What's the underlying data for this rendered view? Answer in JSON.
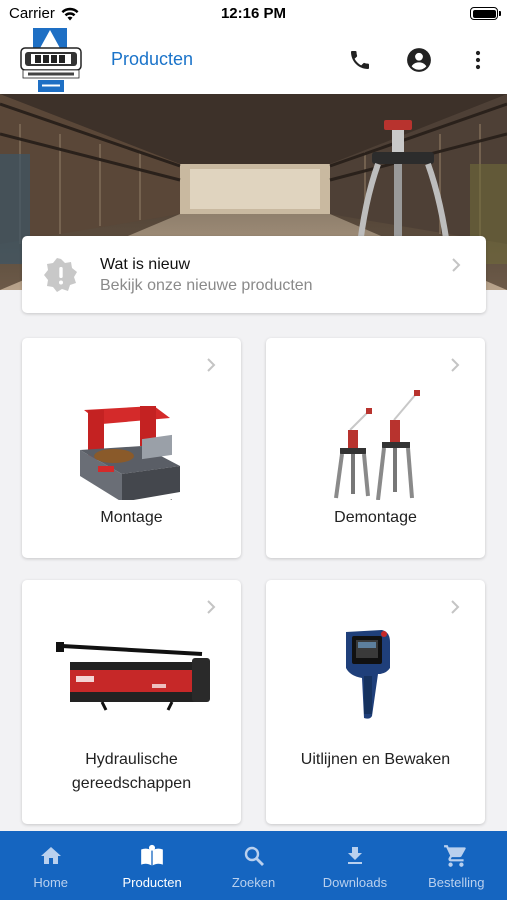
{
  "status_bar": {
    "carrier": "Carrier",
    "time": "12:16 PM"
  },
  "app_bar": {
    "title": "Producten",
    "logo_icon": "bega-logo",
    "actions": [
      {
        "icon": "phone-icon"
      },
      {
        "icon": "account-icon"
      },
      {
        "icon": "more-vert-icon"
      }
    ]
  },
  "news": {
    "title": "Wat is nieuw",
    "subtitle": "Bekijk onze nieuwe producten",
    "icon": "alert-badge-icon"
  },
  "categories": [
    {
      "label": "Montage",
      "image": "induction-heater"
    },
    {
      "label": "Demontage",
      "image": "hydraulic-pullers"
    },
    {
      "label": "Hydraulische gereedschappen",
      "image": "hydraulic-pump"
    },
    {
      "label": "Uitlijnen en Bewaken",
      "image": "infrared-thermometer"
    }
  ],
  "bottom_nav": {
    "active": "Producten",
    "items": [
      {
        "label": "Home",
        "icon": "home-icon"
      },
      {
        "label": "Producten",
        "icon": "product-book-icon"
      },
      {
        "label": "Zoeken",
        "icon": "search-icon"
      },
      {
        "label": "Downloads",
        "icon": "download-icon"
      },
      {
        "label": "Bestelling",
        "icon": "cart-icon"
      }
    ]
  },
  "colors": {
    "brand_blue": "#1565c0",
    "title_blue": "#1a73c9"
  }
}
